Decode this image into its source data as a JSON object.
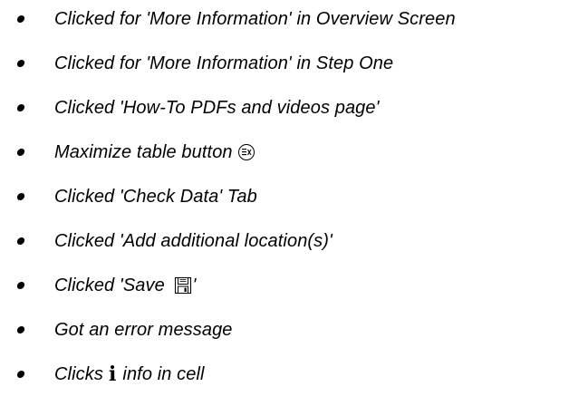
{
  "items": [
    {
      "text": "Clicked for 'More Information' in Overview Screen"
    },
    {
      "text": "Clicked for 'More Information' in Step One"
    },
    {
      "text": "Clicked 'How-To PDFs and videos page'"
    },
    {
      "text": "Maximize table button",
      "icon": "maximize-icon"
    },
    {
      "text": "Clicked 'Check Data' Tab"
    },
    {
      "text": "Clicked 'Add additional location(s)'"
    },
    {
      "text_before": "Clicked 'Save ",
      "icon": "save-disk-icon",
      "text_after": "'"
    },
    {
      "text": "Got an error message"
    },
    {
      "text_before": "Clicks",
      "icon": "info-icon",
      "icon_glyph": "i",
      "text_after": "info in cell"
    }
  ]
}
